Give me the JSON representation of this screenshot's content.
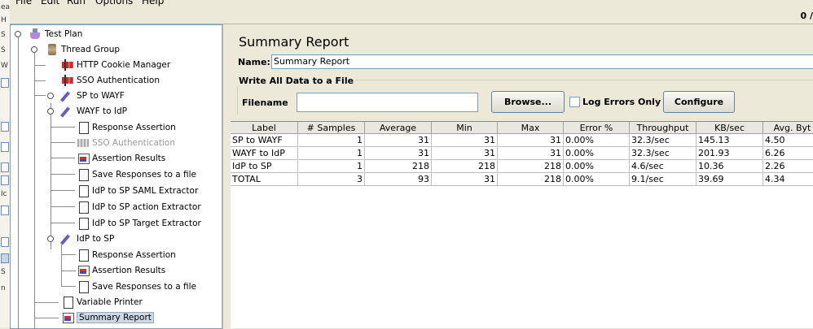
{
  "menu": [
    "File",
    "Edit",
    "Run",
    "Options",
    "Help"
  ],
  "toolbar": {
    "thread_count": "0 /"
  },
  "tree": [
    {
      "label": "Test Plan",
      "icon": "flask-icon"
    },
    {
      "label": "Thread Group",
      "icon": "spool-icon"
    },
    {
      "label": "HTTP Cookie Manager",
      "icon": "config-element-icon"
    },
    {
      "label": "SSO Authentication",
      "icon": "config-element-icon"
    },
    {
      "label": "SP to WAYF",
      "icon": "pipette-sampler-icon"
    },
    {
      "label": "WAYF to IdP",
      "icon": "pipette-sampler-icon"
    },
    {
      "label": "Response Assertion",
      "icon": "document-icon"
    },
    {
      "label": "SSO Authentication",
      "icon": "disabled-config-icon",
      "disabled": true
    },
    {
      "label": "Assertion Results",
      "icon": "chart-listener-icon"
    },
    {
      "label": "Save Responses to a file",
      "icon": "document-icon"
    },
    {
      "label": "IdP to SP SAML Extractor",
      "icon": "document-icon"
    },
    {
      "label": "IdP to SP action Extractor",
      "icon": "document-icon"
    },
    {
      "label": "IdP to SP Target Extractor",
      "icon": "document-icon"
    },
    {
      "label": "IdP to SP",
      "icon": "pipette-sampler-icon"
    },
    {
      "label": "Response Assertion",
      "icon": "document-icon"
    },
    {
      "label": "Assertion Results",
      "icon": "chart-listener-icon"
    },
    {
      "label": "Save Responses to a file",
      "icon": "document-icon"
    },
    {
      "label": "Variable Printer",
      "icon": "document-icon"
    },
    {
      "label": "Summary Report",
      "icon": "chart-listener-icon",
      "selected": true
    }
  ],
  "panel": {
    "title": "Summary Report",
    "name_label": "Name:",
    "name_value": "Summary Report",
    "group_title": "Write All Data to a File",
    "filename_label": "Filename",
    "filename_value": "",
    "browse_label": "Browse...",
    "log_errors_label": "Log Errors Only",
    "log_errors_checked": false,
    "configure_label": "Configure"
  },
  "table": {
    "columns": [
      "Label",
      "# Samples",
      "Average",
      "Min",
      "Max",
      "Error %",
      "Throughput",
      "KB/sec",
      "Avg. Byt"
    ],
    "rows": [
      [
        "SP to WAYF",
        "1",
        "31",
        "31",
        "31",
        "0.00%",
        "32.3/sec",
        "145.13",
        "4.50"
      ],
      [
        "WAYF to IdP",
        "1",
        "31",
        "31",
        "31",
        "0.00%",
        "32.3/sec",
        "201.93",
        "6.26"
      ],
      [
        "IdP to SP",
        "1",
        "218",
        "218",
        "218",
        "0.00%",
        "4.6/sec",
        "10.36",
        "2.26"
      ],
      [
        "TOTAL",
        "3",
        "93",
        "31",
        "218",
        "0.00%",
        "9.1/sec",
        "39.69",
        "4.34"
      ]
    ]
  }
}
